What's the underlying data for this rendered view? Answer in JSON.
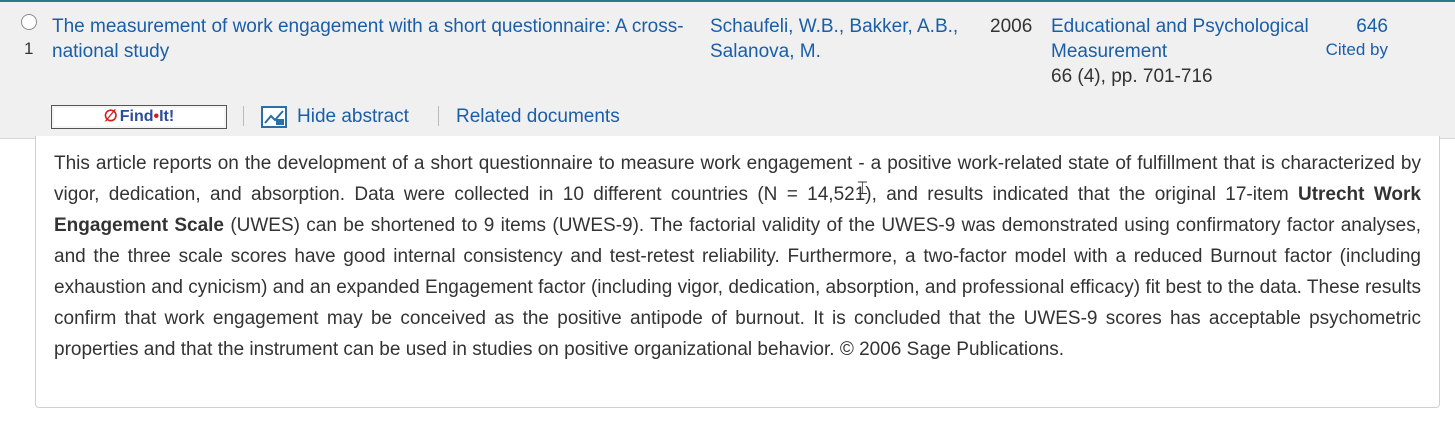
{
  "result": {
    "index": "1",
    "title": "The measurement of work engagement with a short questionnaire: A cross-national study",
    "authors": "Schaufeli, W.B., Bakker, A.B., Salanova, M.",
    "year": "2006",
    "source_title": "Educational and Psychological Measurement",
    "source_volume": "66 (4), pp. 701-716",
    "cited_count": "646",
    "cited_label": "Cited by"
  },
  "actions": {
    "findit_prefix": "Find",
    "findit_dot": "•",
    "findit_suffix": "It!",
    "hide_abstract": "Hide abstract",
    "related_documents": "Related documents"
  },
  "abstract": {
    "part1": "This article reports on the development of a short questionnaire to measure work engagement - a positive work-related state of fulfillment that is characterized by vigor, dedication, and absorption. Data were collected in 10 different countries (N = 14,521), and results indicated that the original 17-item ",
    "highlight": "Utrecht Work Engagement Scale",
    "part2": " (UWES) can be shortened to 9 items (UWES-9). The factorial validity of the UWES-9 was demonstrated using confirmatory factor analyses, and the three scale scores have good internal consistency and test-retest reliability. Furthermore, a two-factor model with a reduced Burnout factor (including exhaustion and cynicism) and an expanded Engagement factor (including vigor, dedication, absorption, and professional efficacy) fit best to the data. These results confirm that work engagement may be conceived as the positive antipode of burnout. It is concluded that the UWES-9 scores has acceptable psychometric properties and that the instrument can be used in studies on positive organizational behavior. © 2006 Sage Publications."
  },
  "colors": {
    "link": "#1a5ea8",
    "row_background": "#f0f0f0",
    "row_top_border": "#2a7a8c",
    "findit_red": "#d02020"
  },
  "icons": {
    "abstract": "abstract-chart-icon",
    "findit_logo": "findit-logo-icon",
    "cursor": "text-cursor-icon"
  }
}
